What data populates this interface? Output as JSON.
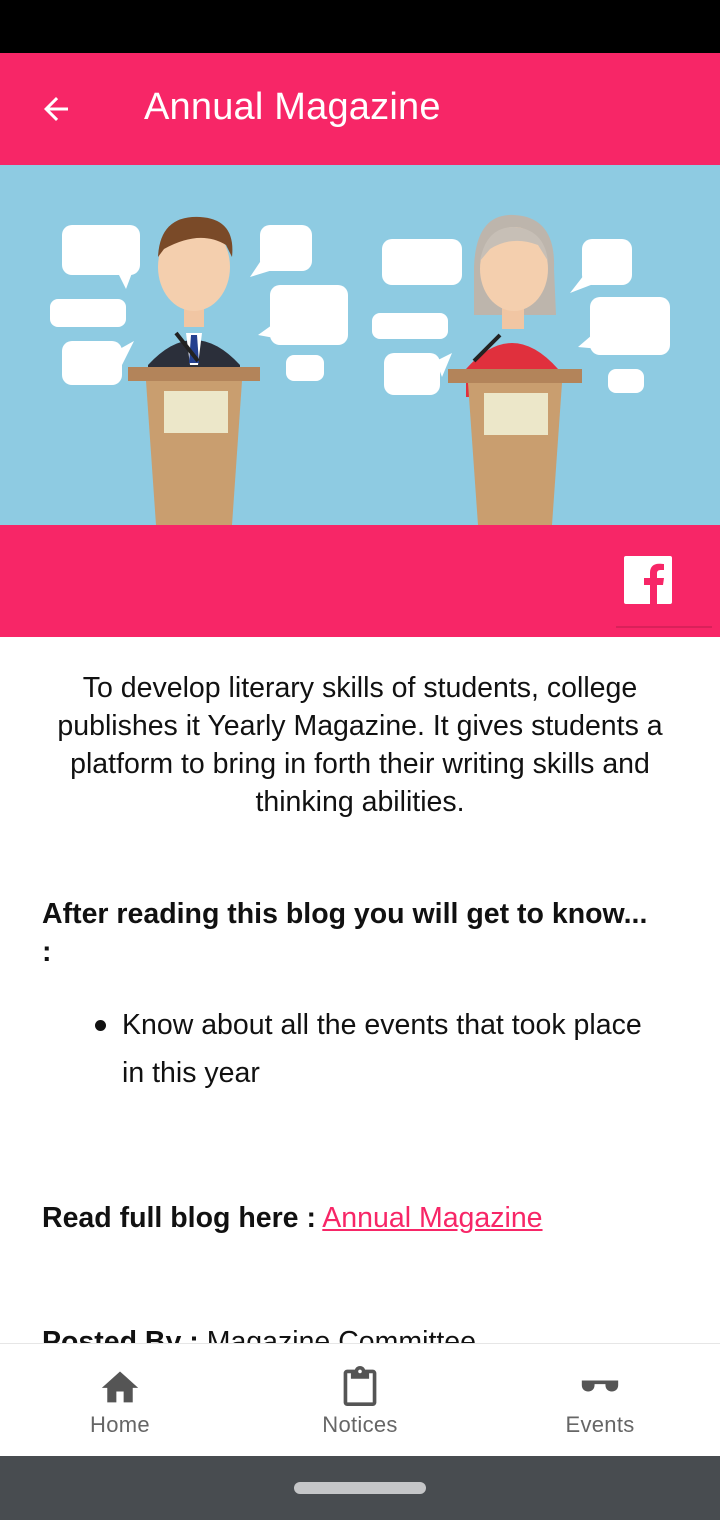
{
  "app_bar": {
    "title": "Annual Magazine",
    "back_icon": "arrow-back-icon",
    "color": "#f72667"
  },
  "hero": {
    "icon": "debate-illustration",
    "background": "#8ecbe2"
  },
  "share": {
    "facebook_icon": "facebook-icon"
  },
  "article": {
    "intro": "To develop literary skills of students, college publishes it Yearly Magazine. It gives students a platform to bring in forth their writing skills and thinking abilities.",
    "heading": "After reading this blog you will get to know... :",
    "bullets": [
      "Know about all the events that took place in this year"
    ],
    "read_label": "Read full blog here :",
    "read_link": "Annual Magazine",
    "posted_label": "Posted By :",
    "posted_value": "Magazine Committee"
  },
  "bottom_nav": {
    "items": [
      {
        "label": "Home",
        "icon": "home-icon"
      },
      {
        "label": "Notices",
        "icon": "clipboard-icon"
      },
      {
        "label": "Events",
        "icon": "sunglasses-icon"
      }
    ]
  }
}
